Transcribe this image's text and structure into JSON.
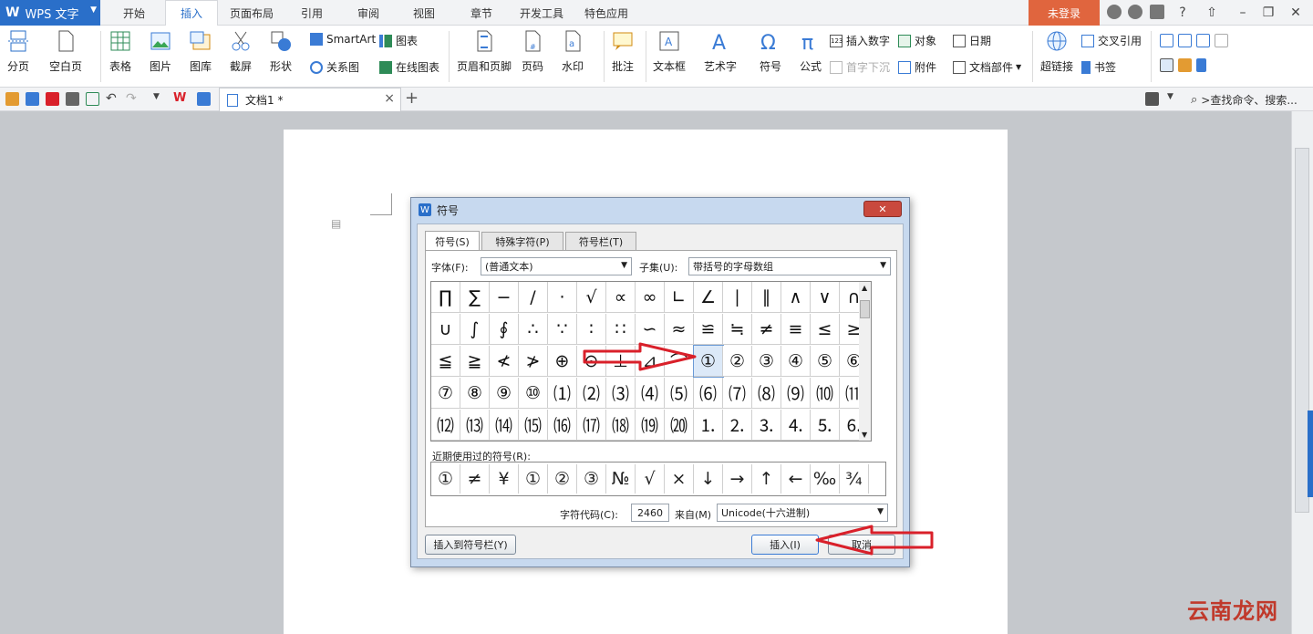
{
  "app": {
    "name": "WPS 文字"
  },
  "ribbon_tabs": [
    "开始",
    "插入",
    "页面布局",
    "引用",
    "审阅",
    "视图",
    "章节",
    "开发工具",
    "特色应用"
  ],
  "login": "未登录",
  "ribbon": {
    "page_break": "分页",
    "blank_page": "空白页",
    "table": "表格",
    "picture": "图片",
    "gallery": "图库",
    "screenshot": "截屏",
    "shapes": "形状",
    "smartart": "SmartArt",
    "chart": "图表",
    "relation": "关系图",
    "online_chart": "在线图表",
    "header_footer": "页眉和页脚",
    "page_number": "页码",
    "watermark": "水印",
    "comment": "批注",
    "textbox": "文本框",
    "wordart": "艺术字",
    "symbol": "符号",
    "formula": "公式",
    "insert_number": "插入数字",
    "object": "对象",
    "date": "日期",
    "drop_cap": "首字下沉",
    "attachment": "附件",
    "doc_parts": "文档部件",
    "hyperlink": "超链接",
    "cross_ref": "交叉引用",
    "bookmark": "书签"
  },
  "doc_tab": "文档1 *",
  "search_placeholder": ">查找命令、搜索...",
  "watermark_text": "云南龙网",
  "dialog": {
    "title": "符号",
    "tabs": [
      "符号(S)",
      "特殊字符(P)",
      "符号栏(T)"
    ],
    "font_label": "字体(F):",
    "font_value": "(普通文本)",
    "subset_label": "子集(U):",
    "subset_value": "带括号的字母数组",
    "symbols": [
      [
        "∏",
        "∑",
        "−",
        "/",
        "·",
        "√",
        "∝",
        "∞",
        "∟",
        "∠",
        "∣",
        "∥",
        "∧",
        "∨",
        "∩"
      ],
      [
        "∪",
        "∫",
        "∮",
        "∴",
        "∵",
        "∶",
        "∷",
        "∽",
        "≈",
        "≌",
        "≒",
        "≠",
        "≡",
        "≤",
        "≥"
      ],
      [
        "≦",
        "≧",
        "≮",
        "≯",
        "⊕",
        "⊙",
        "⊥",
        "⊿",
        "⌒",
        "①",
        "②",
        "③",
        "④",
        "⑤",
        "⑥"
      ],
      [
        "⑦",
        "⑧",
        "⑨",
        "⑩",
        "⑴",
        "⑵",
        "⑶",
        "⑷",
        "⑸",
        "⑹",
        "⑺",
        "⑻",
        "⑼",
        "⑽",
        "⑾"
      ],
      [
        "⑿",
        "⒀",
        "⒁",
        "⒂",
        "⒃",
        "⒄",
        "⒅",
        "⒆",
        "⒇",
        "⒈",
        "⒉",
        "⒊",
        "⒋",
        "⒌",
        "⒍"
      ]
    ],
    "selected_symbol": "①",
    "recent_label": "近期使用过的符号(R):",
    "recent": [
      "①",
      "≠",
      "¥",
      "①",
      "②",
      "③",
      "№",
      "√",
      "×",
      "↓",
      "→",
      "↑",
      "←",
      "‰",
      "¾"
    ],
    "code_label": "字符代码(C):",
    "code_value": "2460",
    "from_label": "来自(M)",
    "from_value": "Unicode(十六进制)",
    "add_to_bar": "插入到符号栏(Y)",
    "insert": "插入(I)",
    "cancel": "取消"
  },
  "colors": {
    "accent": "#2a6fc9",
    "login": "#e0653e",
    "arrow": "#d9202a"
  }
}
